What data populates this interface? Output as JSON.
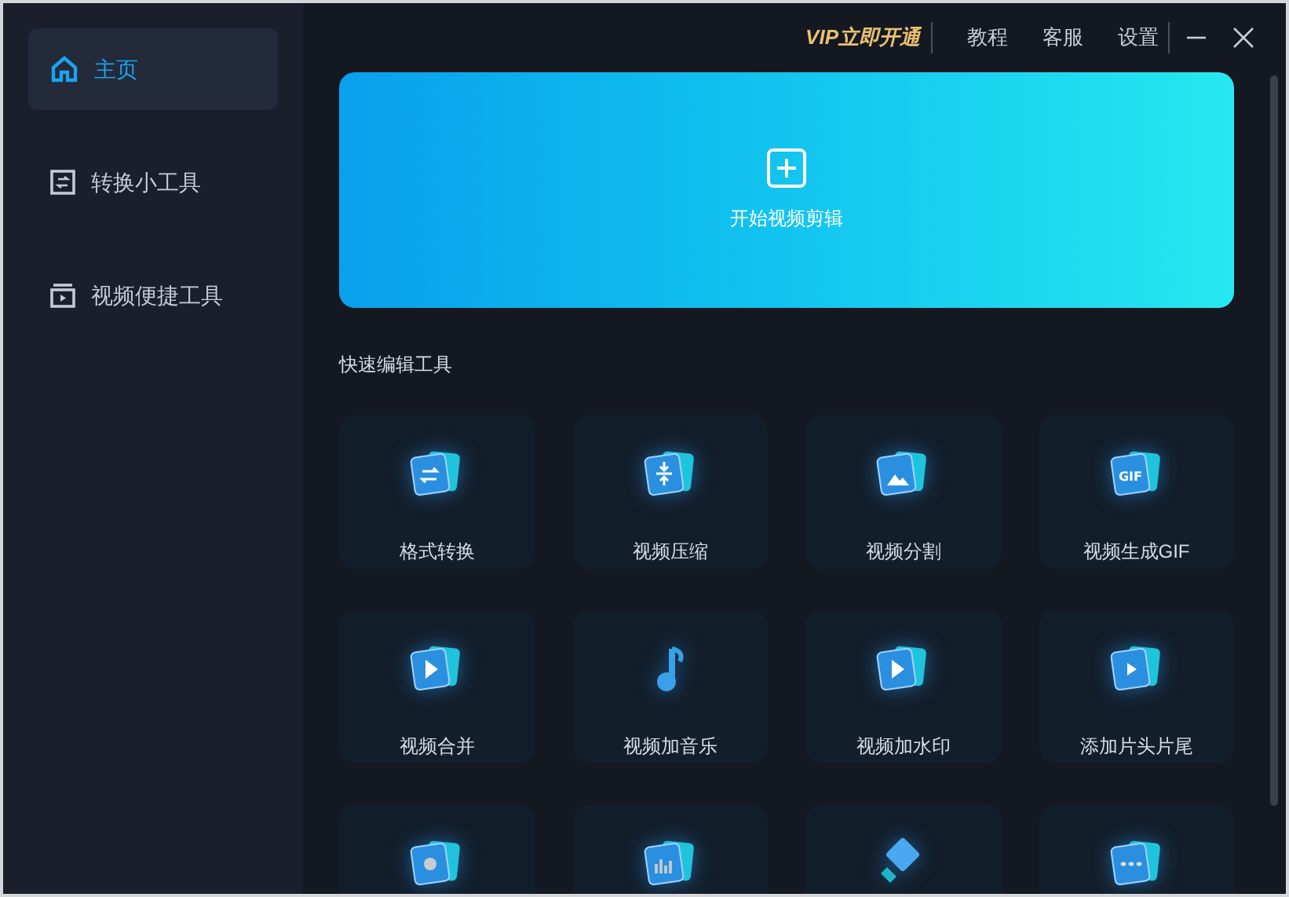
{
  "sidebar": {
    "items": [
      {
        "label": "主页",
        "selected": true
      },
      {
        "label": "转换小工具",
        "selected": false
      },
      {
        "label": "视频便捷工具",
        "selected": false
      }
    ]
  },
  "topbar": {
    "vip": "VIP立即开通",
    "links": [
      "教程",
      "客服",
      "设置"
    ]
  },
  "hero": {
    "label": "开始视频剪辑"
  },
  "quick_tools": {
    "title": "快速编辑工具",
    "items": [
      {
        "label": "格式转换"
      },
      {
        "label": "视频压缩"
      },
      {
        "label": "视频分割"
      },
      {
        "label": "视频生成GIF",
        "icon_text": "GIF"
      },
      {
        "label": "视频合并"
      },
      {
        "label": "视频加音乐"
      },
      {
        "label": "视频加水印"
      },
      {
        "label": "添加片头片尾"
      },
      {
        "cut_off": true
      },
      {
        "cut_off": true
      },
      {
        "cut_off": true
      },
      {
        "cut_off": true
      }
    ]
  }
}
